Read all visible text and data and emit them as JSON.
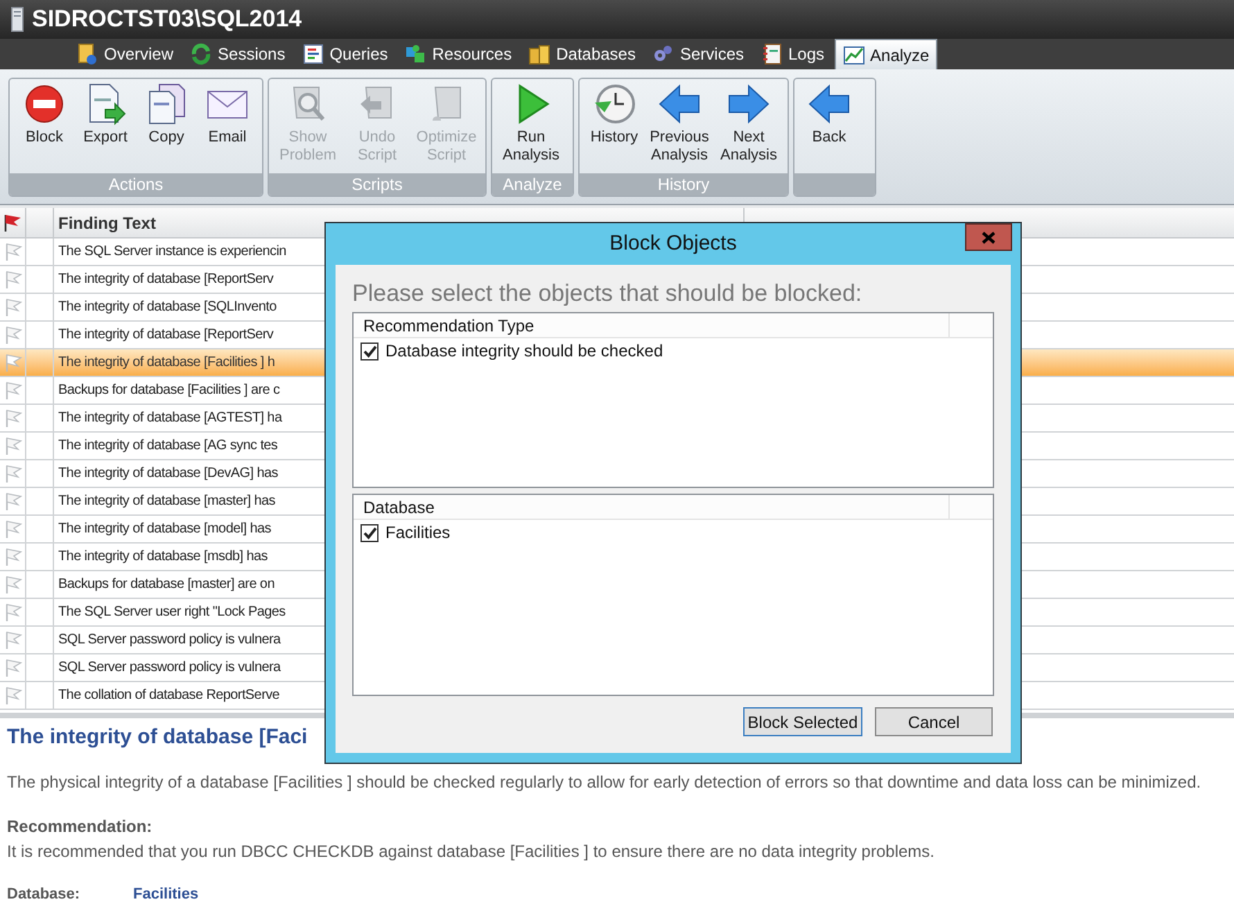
{
  "window": {
    "title": "SIDROCTST03\\SQL2014"
  },
  "tabs": [
    {
      "label": "Overview",
      "kind": "overview",
      "selected": false
    },
    {
      "label": "Sessions",
      "kind": "sessions",
      "selected": false
    },
    {
      "label": "Queries",
      "kind": "queries",
      "selected": false
    },
    {
      "label": "Resources",
      "kind": "resources",
      "selected": false
    },
    {
      "label": "Databases",
      "kind": "databases",
      "selected": false
    },
    {
      "label": "Services",
      "kind": "services",
      "selected": false
    },
    {
      "label": "Logs",
      "kind": "logs",
      "selected": false
    },
    {
      "label": "Analyze",
      "kind": "analyze",
      "selected": true
    }
  ],
  "ribbon": {
    "groups": [
      {
        "label": "Actions",
        "buttons": [
          {
            "label": "Block",
            "kind": "block",
            "disabled": false
          },
          {
            "label": "Export",
            "kind": "export",
            "disabled": false
          },
          {
            "label": "Copy",
            "kind": "copy",
            "disabled": false
          },
          {
            "label": "Email",
            "kind": "email",
            "disabled": false
          }
        ]
      },
      {
        "label": "Scripts",
        "buttons": [
          {
            "label": "Show Problem",
            "kind": "show",
            "disabled": true
          },
          {
            "label": "Undo Script",
            "kind": "undo",
            "disabled": true
          },
          {
            "label": "Optimize Script",
            "kind": "optimize",
            "disabled": true
          }
        ]
      },
      {
        "label": "Analyze",
        "buttons": [
          {
            "label": "Run Analysis",
            "kind": "run",
            "disabled": false
          }
        ]
      },
      {
        "label": "History",
        "buttons": [
          {
            "label": "History",
            "kind": "history",
            "disabled": false
          },
          {
            "label": "Previous Analysis",
            "kind": "prev",
            "disabled": false
          },
          {
            "label": "Next Analysis",
            "kind": "next",
            "disabled": false
          }
        ]
      },
      {
        "buttons": [
          {
            "label": "Back",
            "kind": "back",
            "disabled": false
          }
        ]
      }
    ]
  },
  "grid": {
    "columns": [
      "Finding Text"
    ],
    "rows": [
      {
        "text": "The SQL Server instance is experiencin",
        "selected": false
      },
      {
        "text": "The integrity of database [ReportServ",
        "selected": false
      },
      {
        "text": "The integrity of database [SQLInvento",
        "selected": false
      },
      {
        "text": "The integrity of database [ReportServ",
        "selected": false
      },
      {
        "text": "The integrity of database [Facilities ] h",
        "selected": true
      },
      {
        "text": "Backups for database [Facilities ] are c",
        "selected": false
      },
      {
        "text": "The integrity of database [AGTEST] ha",
        "selected": false
      },
      {
        "text": "The integrity of database [AG sync tes",
        "selected": false
      },
      {
        "text": "The integrity of database [DevAG] has",
        "selected": false
      },
      {
        "text": "The integrity of database [master] has",
        "selected": false
      },
      {
        "text": "The integrity of database [model] has",
        "selected": false
      },
      {
        "text": "The integrity of database [msdb] has",
        "selected": false
      },
      {
        "text": "Backups for database [master] are on",
        "selected": false
      },
      {
        "text": "The SQL Server user right \"Lock Pages",
        "selected": false
      },
      {
        "text": "SQL Server password policy is vulnera",
        "selected": false
      },
      {
        "text": "SQL Server password policy is vulnera",
        "selected": false
      },
      {
        "text": "The collation of database ReportServe",
        "selected": false
      }
    ]
  },
  "detail": {
    "heading": "The integrity of database [Faci",
    "description": "The physical integrity of a database [Facilities ] should be checked regularly to allow for early detection of errors so that downtime and data loss can be minimized.",
    "recommendation_label": "Recommendation:",
    "recommendation": "It is recommended that you run DBCC CHECKDB against database [Facilities ] to ensure there are no data integrity problems.",
    "fields": [
      {
        "label": "Database:",
        "value": "Facilities"
      }
    ]
  },
  "dialog": {
    "title": "Block Objects",
    "prompt": "Please select the objects that should be blocked:",
    "lists": [
      {
        "header": "Recommendation Type",
        "items": [
          {
            "label": "Database integrity should be checked",
            "checked": true
          }
        ]
      },
      {
        "header": "Database",
        "items": [
          {
            "label": "Facilities",
            "checked": true
          }
        ]
      }
    ],
    "buttons": [
      {
        "label": "Block Selected",
        "default": true
      },
      {
        "label": "Cancel",
        "default": false
      }
    ]
  }
}
